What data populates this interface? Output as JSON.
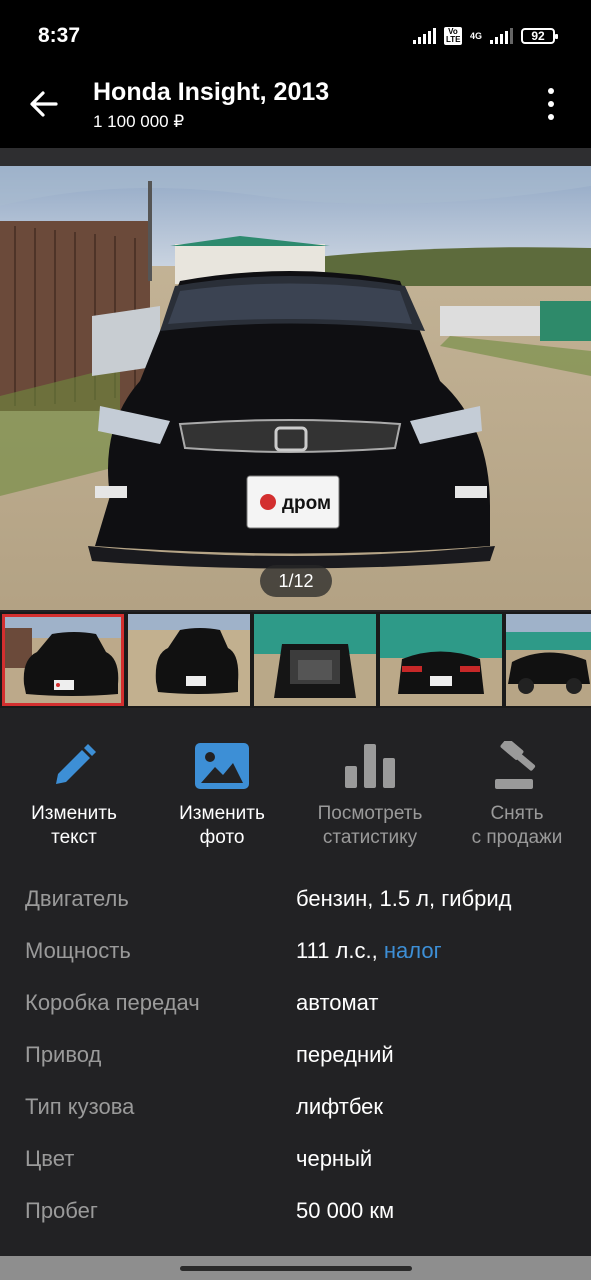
{
  "status": {
    "time": "8:37",
    "volte": "Vo LTE",
    "network": "4G",
    "battery": "92"
  },
  "header": {
    "title": "Honda Insight, 2013",
    "price": "1 100 000 ₽",
    "back_icon": "arrow-left-icon",
    "menu_icon": "more-vertical-icon"
  },
  "gallery": {
    "counter": "1/12",
    "plate_text": "дром"
  },
  "actions": [
    {
      "label_1": "Изменить",
      "label_2": "текст",
      "icon": "pencil-icon",
      "color": "#3d8fd6"
    },
    {
      "label_1": "Изменить",
      "label_2": "фото",
      "icon": "image-icon",
      "color": "#3d8fd6"
    },
    {
      "label_1": "Посмотреть",
      "label_2": "статистику",
      "icon": "bar-chart-icon",
      "color": "#9a9a9a"
    },
    {
      "label_1": "Снять",
      "label_2": "с продажи",
      "icon": "gavel-icon",
      "color": "#9a9a9a"
    }
  ],
  "specs": [
    {
      "key": "Двигатель",
      "value": "бензин, 1.5 л, гибрид"
    },
    {
      "key": "Мощность",
      "value": "111 л.с.,",
      "link": "налог"
    },
    {
      "key": "Коробка передач",
      "value": "автомат"
    },
    {
      "key": "Привод",
      "value": "передний"
    },
    {
      "key": "Тип кузова",
      "value": "лифтбек"
    },
    {
      "key": "Цвет",
      "value": "черный"
    },
    {
      "key": "Пробег",
      "value": "50 000 км"
    }
  ]
}
